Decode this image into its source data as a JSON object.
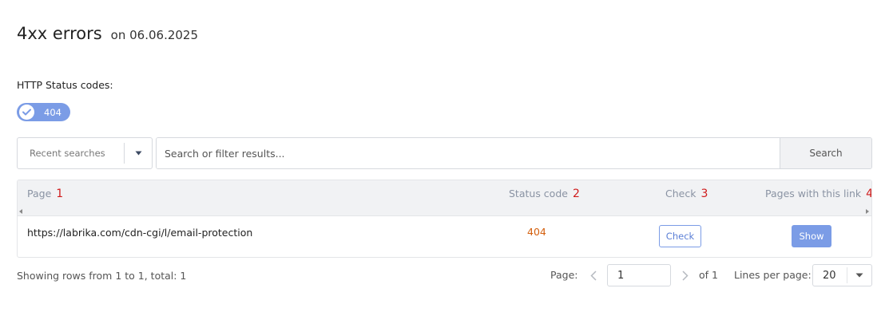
{
  "header": {
    "title": "4xx errors",
    "date": "on 06.06.2025"
  },
  "filters": {
    "label": "HTTP Status codes:",
    "chips": [
      {
        "label": "404",
        "selected": true
      }
    ]
  },
  "search": {
    "recent_label": "Recent searches",
    "placeholder": "Search or filter results...",
    "button_label": "Search"
  },
  "table": {
    "columns": [
      {
        "label": "Page",
        "marker": "1"
      },
      {
        "label": "Status code",
        "marker": "2"
      },
      {
        "label": "Check",
        "marker": "3"
      },
      {
        "label": "Pages with this link",
        "marker": "4"
      }
    ],
    "rows": [
      {
        "page": "https://labrika.com/cdn-cgi/l/email-protection",
        "status": "404",
        "check_label": "Check",
        "show_label": "Show"
      }
    ]
  },
  "footer": {
    "summary": "Showing rows from 1 to 1, total: 1",
    "page_label": "Page:",
    "page_value": "1",
    "of_label": "of 1",
    "lines_label": "Lines per page:",
    "lines_value": "20"
  },
  "colors": {
    "accent": "#7b9ce6",
    "status_error": "#d4600e",
    "marker_red": "#d01b1b"
  }
}
